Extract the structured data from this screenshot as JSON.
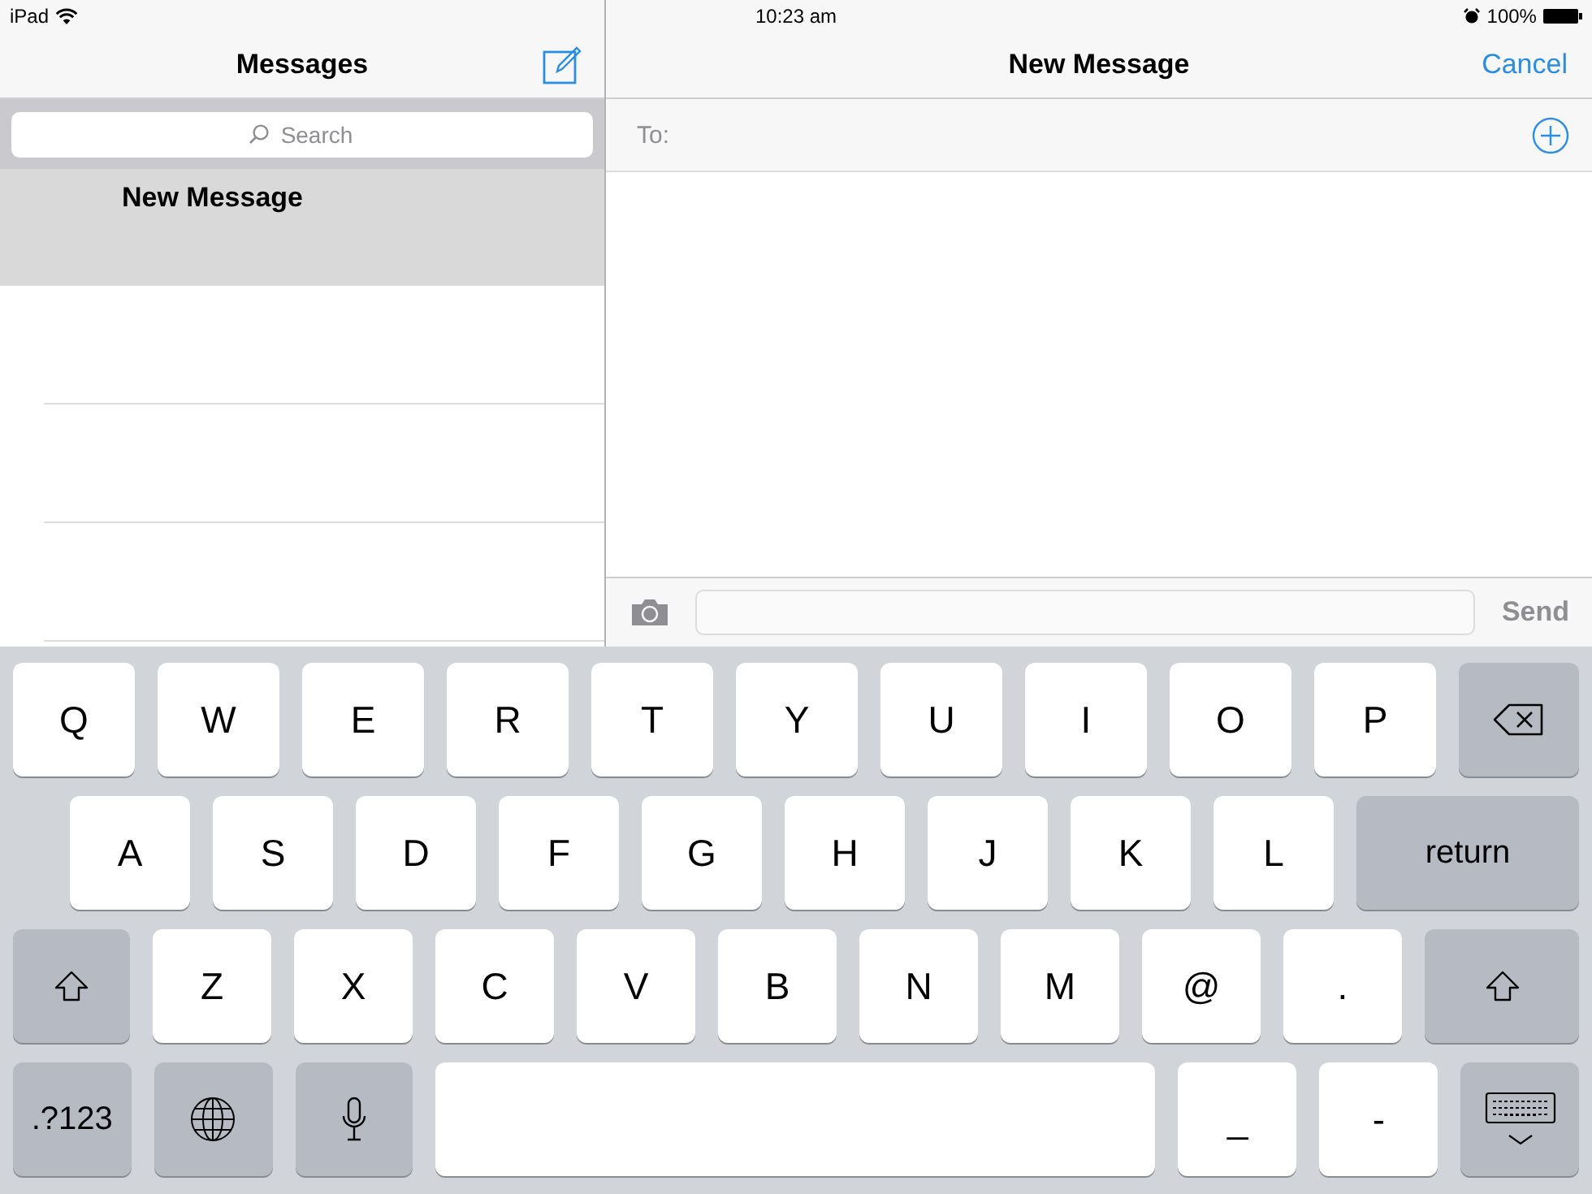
{
  "status_bar": {
    "carrier": "iPad",
    "time": "10:23 am",
    "battery": "100%"
  },
  "sidebar": {
    "title": "Messages",
    "search": {
      "placeholder": "Search"
    },
    "conversations": [
      {
        "title": "New Message",
        "selected": true
      }
    ]
  },
  "compose": {
    "title": "New Message",
    "cancel": "Cancel",
    "to_label": "To:",
    "send": {
      "label": "Send",
      "disabled": true
    }
  },
  "keyboard": {
    "rows": [
      [
        {
          "kind": "letter",
          "label": "Q"
        },
        {
          "kind": "letter",
          "label": "W"
        },
        {
          "kind": "letter",
          "label": "E"
        },
        {
          "kind": "letter",
          "label": "R"
        },
        {
          "kind": "letter",
          "label": "T"
        },
        {
          "kind": "letter",
          "label": "Y"
        },
        {
          "kind": "letter",
          "label": "U"
        },
        {
          "kind": "letter",
          "label": "I"
        },
        {
          "kind": "letter",
          "label": "O"
        },
        {
          "kind": "letter",
          "label": "P"
        },
        {
          "kind": "backspace"
        }
      ],
      [
        {
          "kind": "letter",
          "label": "A"
        },
        {
          "kind": "letter",
          "label": "S"
        },
        {
          "kind": "letter",
          "label": "D"
        },
        {
          "kind": "letter",
          "label": "F"
        },
        {
          "kind": "letter",
          "label": "G"
        },
        {
          "kind": "letter",
          "label": "H"
        },
        {
          "kind": "letter",
          "label": "J"
        },
        {
          "kind": "letter",
          "label": "K"
        },
        {
          "kind": "letter",
          "label": "L"
        },
        {
          "kind": "function",
          "label": "return"
        }
      ],
      [
        {
          "kind": "shift"
        },
        {
          "kind": "letter",
          "label": "Z"
        },
        {
          "kind": "letter",
          "label": "X"
        },
        {
          "kind": "letter",
          "label": "C"
        },
        {
          "kind": "letter",
          "label": "V"
        },
        {
          "kind": "letter",
          "label": "B"
        },
        {
          "kind": "letter",
          "label": "N"
        },
        {
          "kind": "letter",
          "label": "M"
        },
        {
          "kind": "letter",
          "label": "@"
        },
        {
          "kind": "letter",
          "label": "."
        },
        {
          "kind": "shift"
        }
      ],
      [
        {
          "kind": "function",
          "label": ".?123"
        },
        {
          "kind": "globe"
        },
        {
          "kind": "mic"
        },
        {
          "kind": "space"
        },
        {
          "kind": "letter",
          "label": "_"
        },
        {
          "kind": "letter",
          "label": "-"
        },
        {
          "kind": "hide"
        }
      ]
    ]
  }
}
